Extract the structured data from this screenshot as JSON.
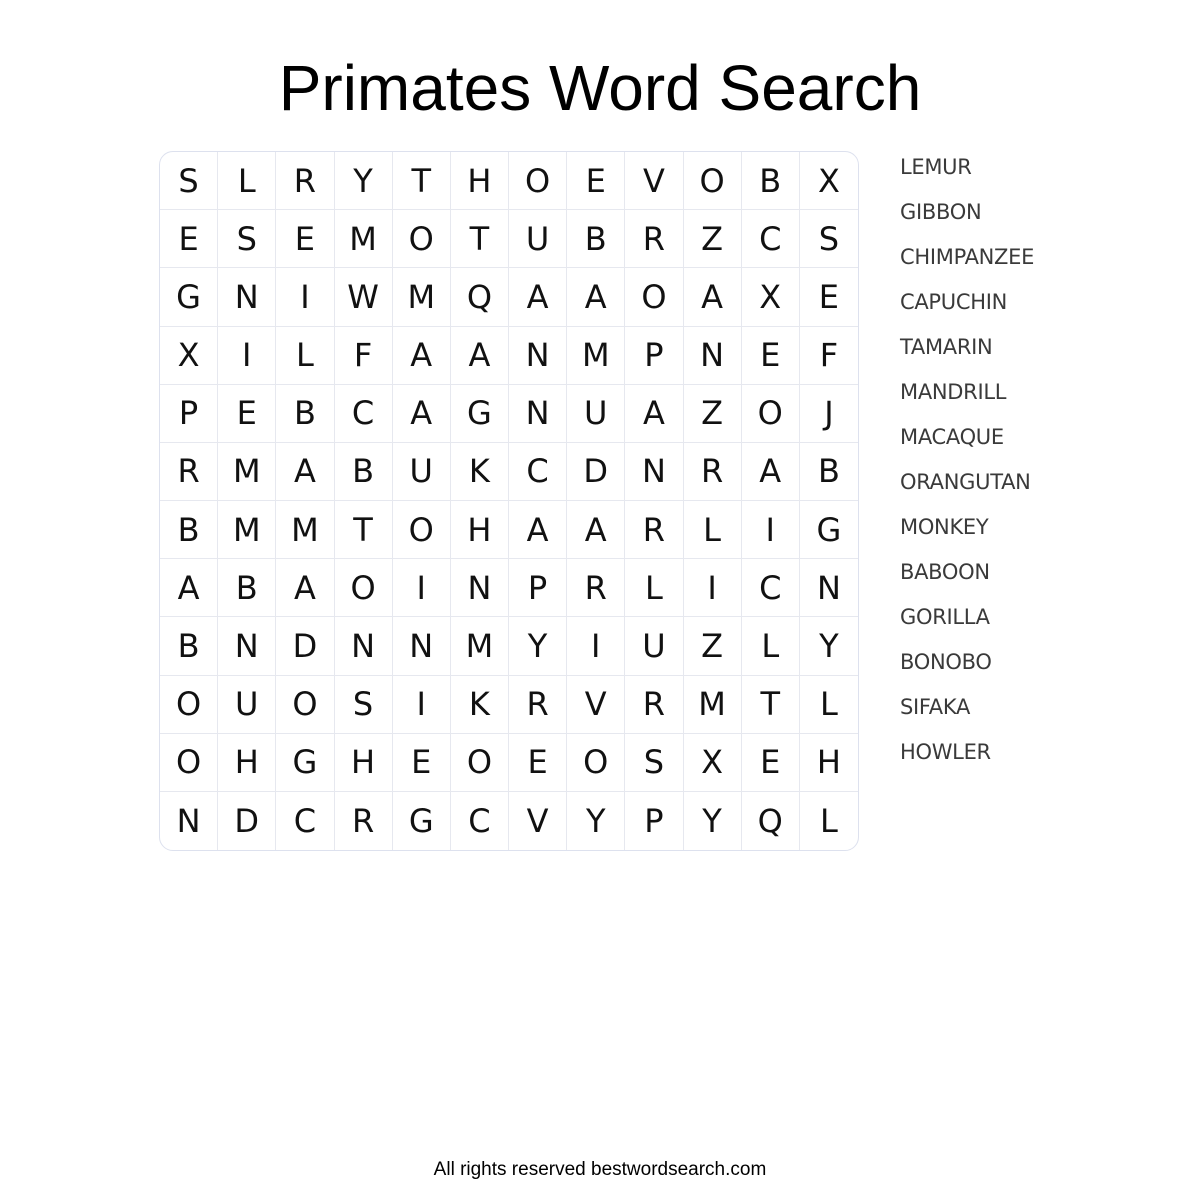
{
  "title": "Primates Word Search",
  "grid": [
    [
      "S",
      "L",
      "R",
      "Y",
      "T",
      "H",
      "O",
      "E",
      "V",
      "O",
      "B",
      "X"
    ],
    [
      "E",
      "S",
      "E",
      "M",
      "O",
      "T",
      "U",
      "B",
      "R",
      "Z",
      "C",
      "S"
    ],
    [
      "G",
      "N",
      "I",
      "W",
      "M",
      "Q",
      "A",
      "A",
      "O",
      "A",
      "X",
      "E"
    ],
    [
      "X",
      "I",
      "L",
      "F",
      "A",
      "A",
      "N",
      "M",
      "P",
      "N",
      "E",
      "F"
    ],
    [
      "P",
      "E",
      "B",
      "C",
      "A",
      "G",
      "N",
      "U",
      "A",
      "Z",
      "O",
      "J"
    ],
    [
      "R",
      "M",
      "A",
      "B",
      "U",
      "K",
      "C",
      "D",
      "N",
      "R",
      "A",
      "B"
    ],
    [
      "B",
      "M",
      "M",
      "T",
      "O",
      "H",
      "A",
      "A",
      "R",
      "L",
      "I",
      "G"
    ],
    [
      "A",
      "B",
      "A",
      "O",
      "I",
      "N",
      "P",
      "R",
      "L",
      "I",
      "C",
      "N"
    ],
    [
      "B",
      "N",
      "D",
      "N",
      "N",
      "M",
      "Y",
      "I",
      "U",
      "Z",
      "L",
      "Y"
    ],
    [
      "O",
      "U",
      "O",
      "S",
      "I",
      "K",
      "R",
      "V",
      "R",
      "M",
      "T",
      "L"
    ],
    [
      "O",
      "H",
      "G",
      "H",
      "E",
      "O",
      "E",
      "O",
      "S",
      "X",
      "E",
      "H"
    ],
    [
      "N",
      "D",
      "C",
      "R",
      "G",
      "C",
      "V",
      "Y",
      "P",
      "Y",
      "Q",
      "L"
    ]
  ],
  "words": [
    "LEMUR",
    "GIBBON",
    "CHIMPANZEE",
    "CAPUCHIN",
    "TAMARIN",
    "MANDRILL",
    "MACAQUE",
    "ORANGUTAN",
    "MONKEY",
    "BABOON",
    "GORILLA",
    "BONOBO",
    "SIFAKA",
    "HOWLER"
  ],
  "footer": "All rights reserved bestwordsearch.com"
}
